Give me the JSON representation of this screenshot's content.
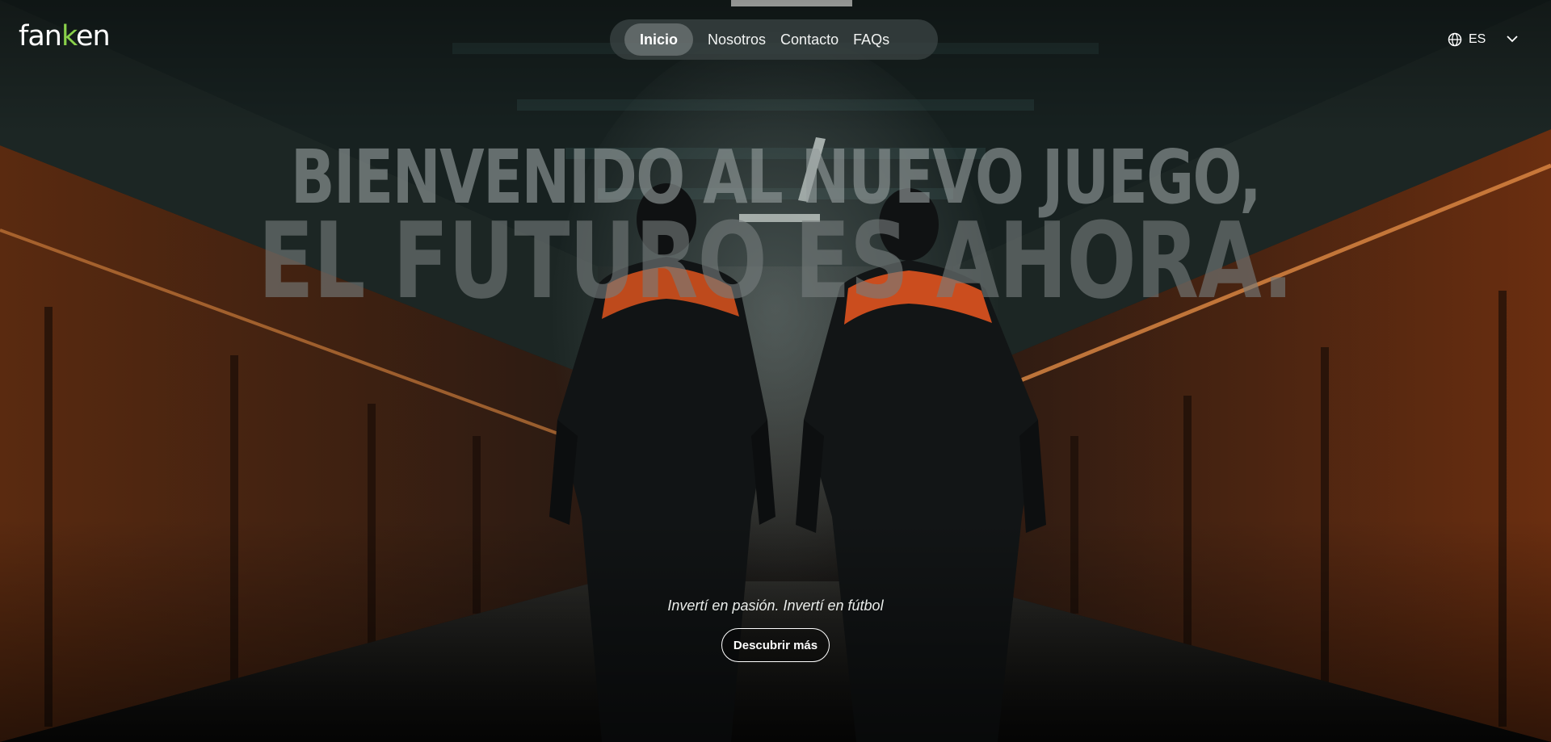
{
  "header": {
    "logo": {
      "text_before": "fan",
      "text_accent": "k",
      "text_after": "en",
      "accent_color": "#8ad14a"
    },
    "nav": {
      "items": [
        {
          "label": "Inicio",
          "active": true
        },
        {
          "label": "Nosotros",
          "active": false
        },
        {
          "label": "Contacto",
          "active": false
        },
        {
          "label": "FAQs",
          "active": false
        }
      ]
    },
    "language": {
      "code": "ES",
      "icon": "globe-icon",
      "dropdown_icon": "chevron-down-icon"
    }
  },
  "hero": {
    "headline_line1": "Bienvenido al nuevo juego,",
    "headline_line2": "el futuro es ahora.",
    "tagline": "Invertí en pasión. Invertí en fútbol",
    "cta_label": "Descubrir más",
    "accent_colors": {
      "jacket_orange": "#e0531f",
      "corridor_orange": "#8a3a14"
    }
  }
}
